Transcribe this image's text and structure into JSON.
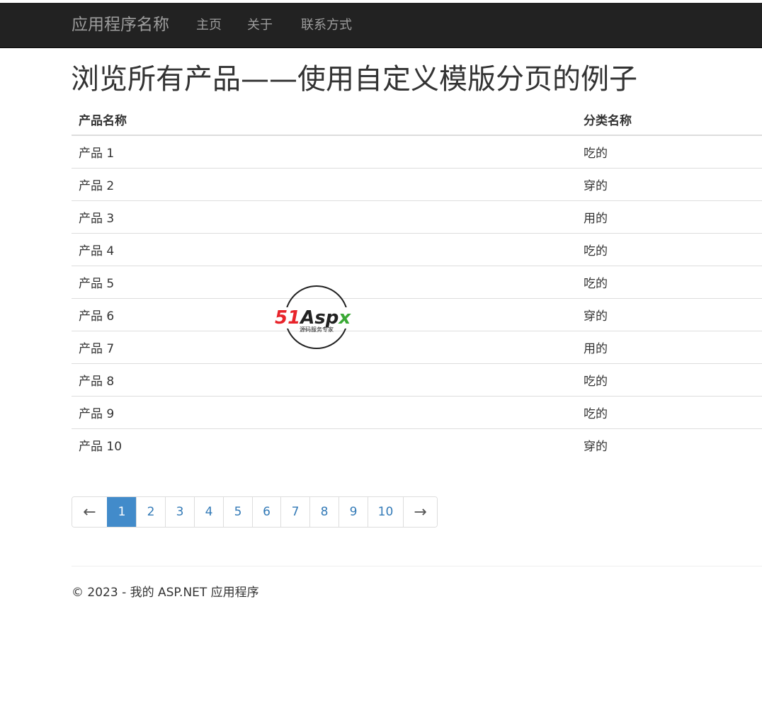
{
  "navbar": {
    "brand": "应用程序名称",
    "links": [
      "主页",
      "关于",
      "联系方式"
    ]
  },
  "page": {
    "title": "浏览所有产品——使用自定义模版分页的例子"
  },
  "table": {
    "headers": [
      "产品名称",
      "分类名称"
    ],
    "rows": [
      [
        "产品 1",
        "吃的"
      ],
      [
        "产品 2",
        "穿的"
      ],
      [
        "产品 3",
        "用的"
      ],
      [
        "产品 4",
        "吃的"
      ],
      [
        "产品 5",
        "吃的"
      ],
      [
        "产品 6",
        "穿的"
      ],
      [
        "产品 7",
        "用的"
      ],
      [
        "产品 8",
        "吃的"
      ],
      [
        "产品 9",
        "吃的"
      ],
      [
        "产品 10",
        "穿的"
      ]
    ]
  },
  "pagination": {
    "prev": "←",
    "pages": [
      "1",
      "2",
      "3",
      "4",
      "5",
      "6",
      "7",
      "8",
      "9",
      "10"
    ],
    "current": "1",
    "next": "→"
  },
  "footer": {
    "text": "© 2023 - 我的 ASP.NET 应用程序"
  },
  "watermark": {
    "brand_red": "51",
    "brand_dark": "Asp",
    "brand_green": "x",
    "tagline": "源码服务专家"
  },
  "colors": {
    "navbar_bg": "#222222",
    "link": "#337ab7",
    "active_page": "#428bca",
    "watermark_red": "#e8242b",
    "watermark_green": "#3aa935"
  }
}
